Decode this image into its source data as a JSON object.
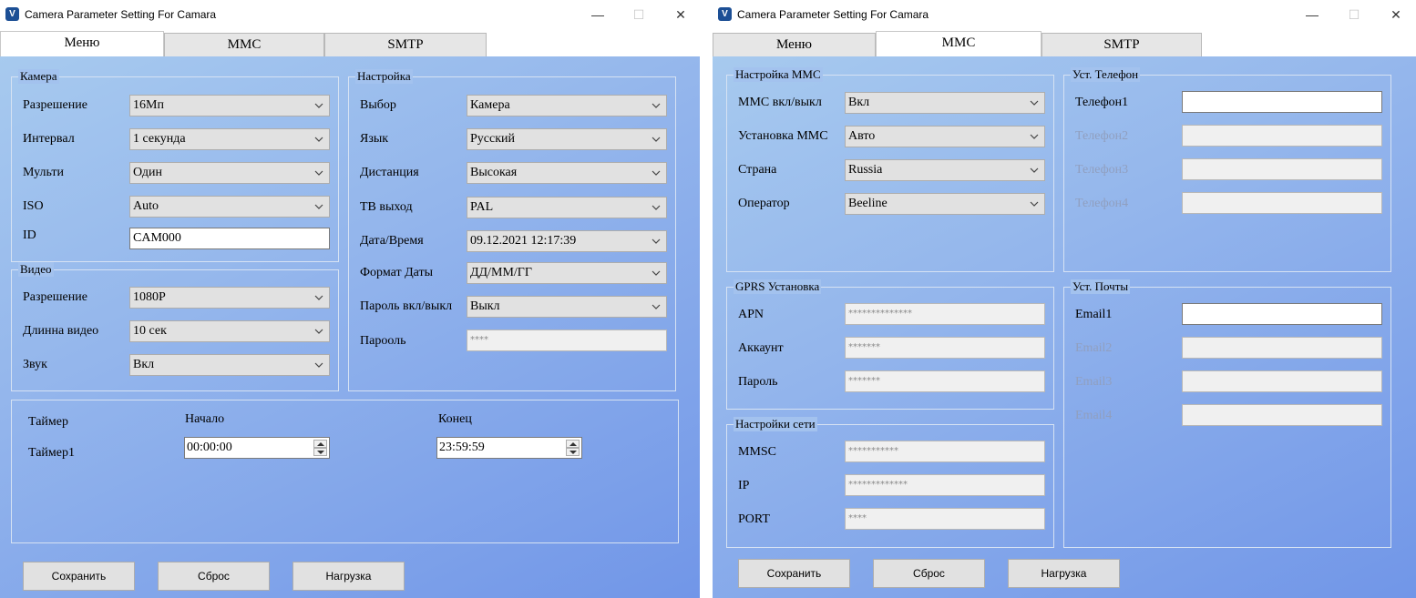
{
  "window_title": "Camera Parameter Setting For  Camara",
  "window_controls": {
    "minimize": "—",
    "maximize": "☐",
    "close": "✕"
  },
  "tabs": [
    "Меню",
    "MMC",
    "SMTP"
  ],
  "left": {
    "camera": {
      "title": "Камера",
      "resolution": {
        "label": "Разрешение",
        "value": "16Мп"
      },
      "interval": {
        "label": "Интервал",
        "value": "1 секунда"
      },
      "multi": {
        "label": "Мульти",
        "value": "Один"
      },
      "iso": {
        "label": "ISO",
        "value": "Auto"
      },
      "id": {
        "label": "ID",
        "value": "CAM000"
      }
    },
    "video": {
      "title": "Видео",
      "resolution": {
        "label": "Разрешение",
        "value": "1080P"
      },
      "length": {
        "label": "Длинна видео",
        "value": "10 сек"
      },
      "sound": {
        "label": "Звук",
        "value": "Вкл"
      }
    },
    "settings": {
      "title": "Настройка",
      "mode": {
        "label": "Выбор",
        "value": "Камера"
      },
      "language": {
        "label": "Язык",
        "value": "Русский"
      },
      "distance": {
        "label": "Дистанция",
        "value": "Высокая"
      },
      "tv_out": {
        "label": "ТВ выход",
        "value": "PAL"
      },
      "datetime": {
        "label": "Дата/Время",
        "value": "09.12.2021 12:17:39"
      },
      "date_format": {
        "label": "Формат Даты",
        "value": "ДД/ММ/ГГ"
      },
      "password_toggle": {
        "label": "Пароль вкл/выкл",
        "value": "Выкл"
      },
      "password": {
        "label": "Парооль",
        "value": "****"
      }
    },
    "timer": {
      "label": "Таймер",
      "row_label": "Таймер1",
      "start_label": "Начало",
      "end_label": "Конец",
      "start_value": "00:00:00",
      "end_value": "23:59:59"
    }
  },
  "right": {
    "mms": {
      "title": "Настройка MMC",
      "toggle": {
        "label": "MMC вкл/выкл",
        "value": "Вкл"
      },
      "setup": {
        "label": "Установка MMC",
        "value": "Авто"
      },
      "country": {
        "label": "Страна",
        "value": "Russia"
      },
      "operator": {
        "label": "Оператор",
        "value": "Beeline"
      }
    },
    "phones": {
      "title": "Уст. Телефон",
      "items": [
        {
          "label": "Телефон1",
          "value": ""
        },
        {
          "label": "Телефон2",
          "value": ""
        },
        {
          "label": "Телефон3",
          "value": ""
        },
        {
          "label": "Телефон4",
          "value": ""
        }
      ]
    },
    "gprs": {
      "title": "GPRS Установка",
      "apn": {
        "label": "APN",
        "value": "**************"
      },
      "account": {
        "label": "Аккаунт",
        "value": "*******"
      },
      "password": {
        "label": "Пароль",
        "value": "*******"
      }
    },
    "emails": {
      "title": "Уст. Почты",
      "items": [
        {
          "label": "Email1",
          "value": ""
        },
        {
          "label": "Email2",
          "value": ""
        },
        {
          "label": "Email3",
          "value": ""
        },
        {
          "label": "Email4",
          "value": ""
        }
      ]
    },
    "network": {
      "title": "Настройки сети",
      "mmsc": {
        "label": "MMSC",
        "value": "***********"
      },
      "ip": {
        "label": "IP",
        "value": "*************"
      },
      "port": {
        "label": "PORT",
        "value": "****"
      }
    }
  },
  "buttons": {
    "save": "Сохранить",
    "reset": "Сброс",
    "load": "Нагрузка"
  }
}
